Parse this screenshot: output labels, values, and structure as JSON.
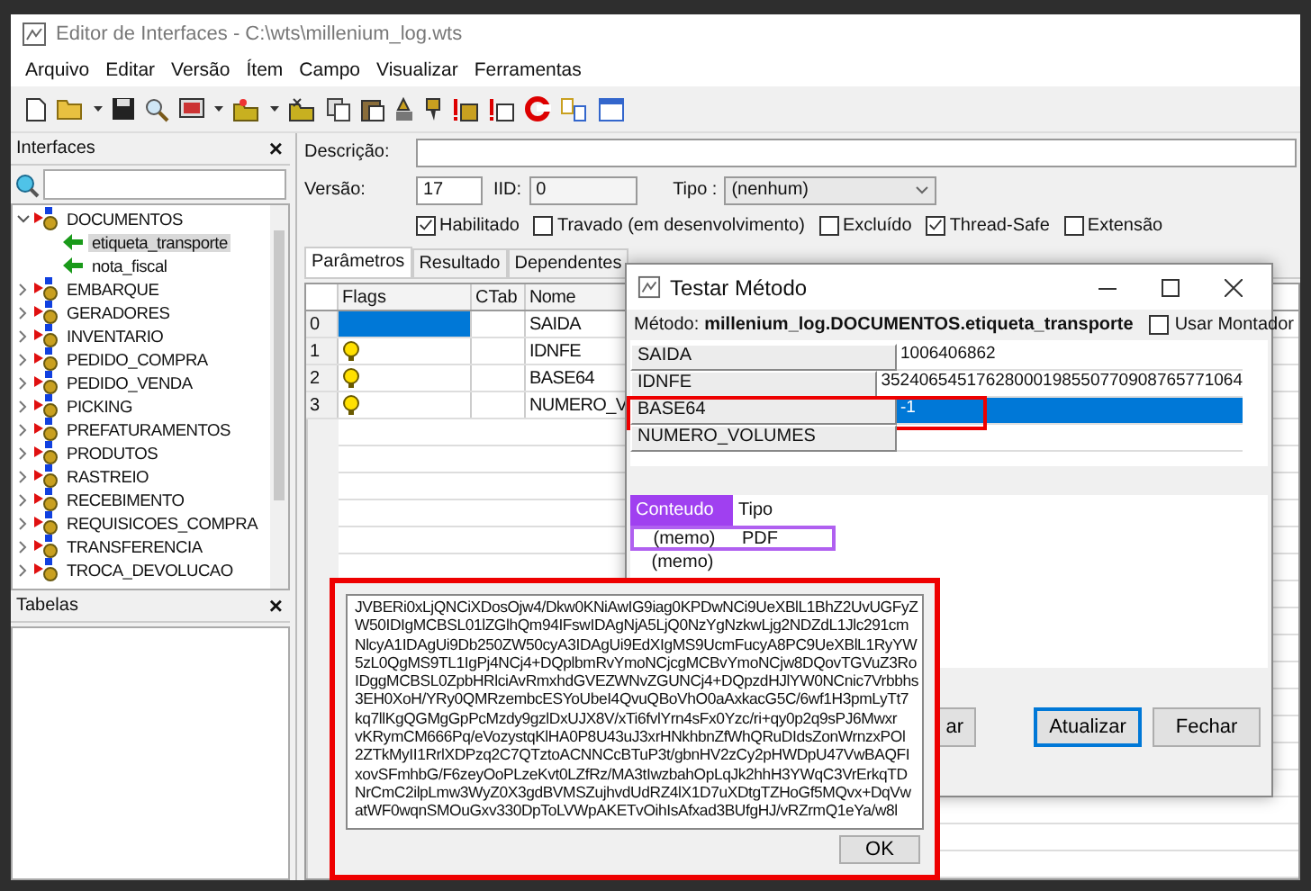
{
  "window": {
    "title": "Editor de Interfaces - C:\\wts\\millenium_log.wts"
  },
  "menu": [
    "Arquivo",
    "Editar",
    "Versão",
    "Ítem",
    "Campo",
    "Visualizar",
    "Ferramentas"
  ],
  "interfaces_panel": {
    "title": "Interfaces",
    "close": "×",
    "tree": [
      {
        "label": "DOCUMENTOS",
        "expanded": true,
        "children": [
          {
            "label": "etiqueta_transporte",
            "selected": true
          },
          {
            "label": "nota_fiscal",
            "selected": false
          }
        ]
      },
      {
        "label": "EMBARQUE",
        "expanded": false
      },
      {
        "label": "GERADORES",
        "expanded": false
      },
      {
        "label": "INVENTARIO",
        "expanded": false
      },
      {
        "label": "PEDIDO_COMPRA",
        "expanded": false
      },
      {
        "label": "PEDIDO_VENDA",
        "expanded": false
      },
      {
        "label": "PICKING",
        "expanded": false
      },
      {
        "label": "PREFATURAMENTOS",
        "expanded": false
      },
      {
        "label": "PRODUTOS",
        "expanded": false
      },
      {
        "label": "RASTREIO",
        "expanded": false
      },
      {
        "label": "RECEBIMENTO",
        "expanded": false
      },
      {
        "label": "REQUISICOES_COMPRA",
        "expanded": false
      },
      {
        "label": "TRANSFERENCIA",
        "expanded": false
      },
      {
        "label": "TROCA_DEVOLUCAO",
        "expanded": false
      }
    ]
  },
  "tabelas_panel": {
    "title": "Tabelas",
    "close": "×"
  },
  "form": {
    "descricao_label": "Descrição:",
    "versao_label": "Versão:",
    "versao": "17",
    "iid_label": "IID:",
    "iid": "0",
    "tipo_label": "Tipo :",
    "tipo": "(nenhum)",
    "checkboxes": [
      {
        "label": "Habilitado",
        "checked": true
      },
      {
        "label": "Travado (em desenvolvimento)",
        "checked": false
      },
      {
        "label": "Excluído",
        "checked": false
      },
      {
        "label": "Thread-Safe",
        "checked": true
      },
      {
        "label": "Extensão",
        "checked": false
      }
    ]
  },
  "tabs": [
    {
      "label": "Parâmetros",
      "selected": true
    },
    {
      "label": "Resultado",
      "selected": false
    },
    {
      "label": "Dependentes",
      "selected": false
    }
  ],
  "grid": {
    "columns": [
      "Flags",
      "CTab",
      "Nome"
    ],
    "rows": [
      {
        "index": "0",
        "flag": false,
        "nome": "SAIDA",
        "selected": true
      },
      {
        "index": "1",
        "flag": true,
        "nome": "IDNFE",
        "selected": false
      },
      {
        "index": "2",
        "flag": true,
        "nome": "BASE64",
        "selected": false
      },
      {
        "index": "3",
        "flag": true,
        "nome": "NUMERO_V",
        "selected": false
      }
    ]
  },
  "dialog": {
    "title": "Testar Método",
    "method_label": "Método:",
    "method": "millenium_log.DOCUMENTOS.etiqueta_transporte",
    "usar_montador": {
      "label": "Usar Montador",
      "checked": false
    },
    "params": [
      {
        "name": "SAIDA",
        "value": "1006406862",
        "selected": false,
        "highlighted": false
      },
      {
        "name": "IDNFE",
        "value": "35240654517628000198550770908765771064",
        "selected": false,
        "highlighted": false
      },
      {
        "name": "BASE64",
        "value": "-1",
        "selected": true,
        "highlighted": true
      },
      {
        "name": "NUMERO_VOLUMES",
        "selected": false,
        "highlighted": false
      }
    ],
    "result_columns": [
      {
        "label": "Conteudo",
        "highlighted": true
      },
      {
        "label": "Tipo",
        "highlighted": false
      }
    ],
    "results": [
      {
        "conteudo": "(memo)",
        "tipo": "PDF",
        "selected": true
      },
      {
        "conteudo": "(memo)",
        "selected": false
      }
    ],
    "buttons": [
      {
        "label": "ar",
        "default": false
      },
      {
        "label": "Atualizar",
        "default": true
      },
      {
        "label": "Fechar",
        "default": false
      }
    ]
  },
  "memo": {
    "highlighted": true,
    "ok": "OK",
    "lines": [
      "JVBERi0xLjQNCiXDosOjw4/Dkw0KNiAwIG9iag0KPDwNCi9UeXBlL1BhZ2UvUGFyZ",
      "W50IDIgMCBSL01lZGlhQm94IFswIDAgNjA5LjQ0NzYgNzkwLjg2NDZdL1Jlc291cm",
      "NlcyA1IDAgUi9Db250ZW50cyA3IDAgUi9EdXIgMS9UcmFucyA8PC9UeXBlL1RyYW",
      "5zL0QgMS9TL1IgPj4NCj4+DQplbmRvYmoNCjcgMCBvYmoNCjw8DQovTGVuZ3Ro",
      "IDggMCBSL0ZpbHRlciAvRmxhdGVEZWNvZGUNCj4+DQpzdHJlYW0NCnic7Vrbbhs",
      "3EH0XoH/YRy0QMRzembcESYoUbeI4QvuQBoVhO0aAxkacG5C/6wf1H3pmLyTt7",
      "kq7llKgQGMgGpPcMzdy9gzlDxUJX8V/xTi6fvlYrn4sFx0Yzc/ri+qy0p2q9sPJ6Mwxr",
      "vKRymCM666Pq/eVozystqKlHA0P8U43uJ3xrHNkhbnZfWhQRuDIdsZonWrnzxPOl",
      "2ZTkMyII1RrlXDPzq2C7QTztoACNNCcBTuP3t/gbnHV2zCy2pHWDpU47VwBAQFI",
      "xovSFmhbG/F6zeyOoPLzeKvt0LZfRz/MA3tIwzbahOpLqJk2hhH3YWqC3VrErkqTD",
      "NrCmC2ilpLmw3WyZ0X3gdBVMSZujhvdUdRZ4lX1D7uXDtgTZHoGf5MQvx+DqVw",
      "atWF0wqnSMOuGxv330DpToLVWpAKETvOihIsAfxad3BUfgHJ/vRZrmQ1eYa/w8l"
    ]
  }
}
